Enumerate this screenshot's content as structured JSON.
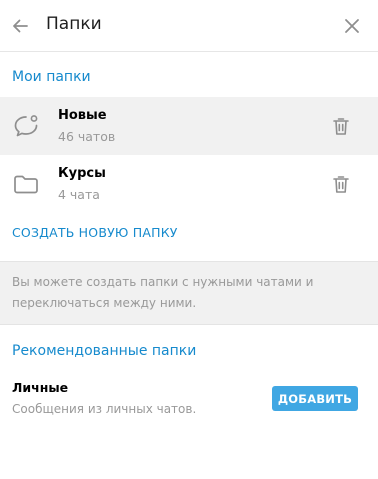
{
  "header": {
    "title": "Папки",
    "back_icon": "arrow-left-icon",
    "close_icon": "close-icon"
  },
  "my_folders": {
    "section_title": "Мои папки",
    "items": [
      {
        "name": "Новые",
        "count": "46 чатов",
        "icon": "chat-bubble-icon",
        "highlighted": true
      },
      {
        "name": "Курсы",
        "count": "4 чата",
        "icon": "folder-icon",
        "highlighted": false
      }
    ],
    "create_label": "СОЗДАТЬ НОВУЮ ПАПКУ"
  },
  "info": {
    "text": "Вы можете создать папки с нужными чатами и переключаться между ними."
  },
  "recommended": {
    "section_title": "Рекомендованные папки",
    "items": [
      {
        "name": "Личные",
        "description": "Сообщения из личных чатов.",
        "button_label": "ДОБАВИТЬ"
      }
    ]
  },
  "colors": {
    "accent": "#168acd",
    "button": "#40a7e3",
    "muted_text": "#999999",
    "hover_bg": "#f1f1f1"
  }
}
